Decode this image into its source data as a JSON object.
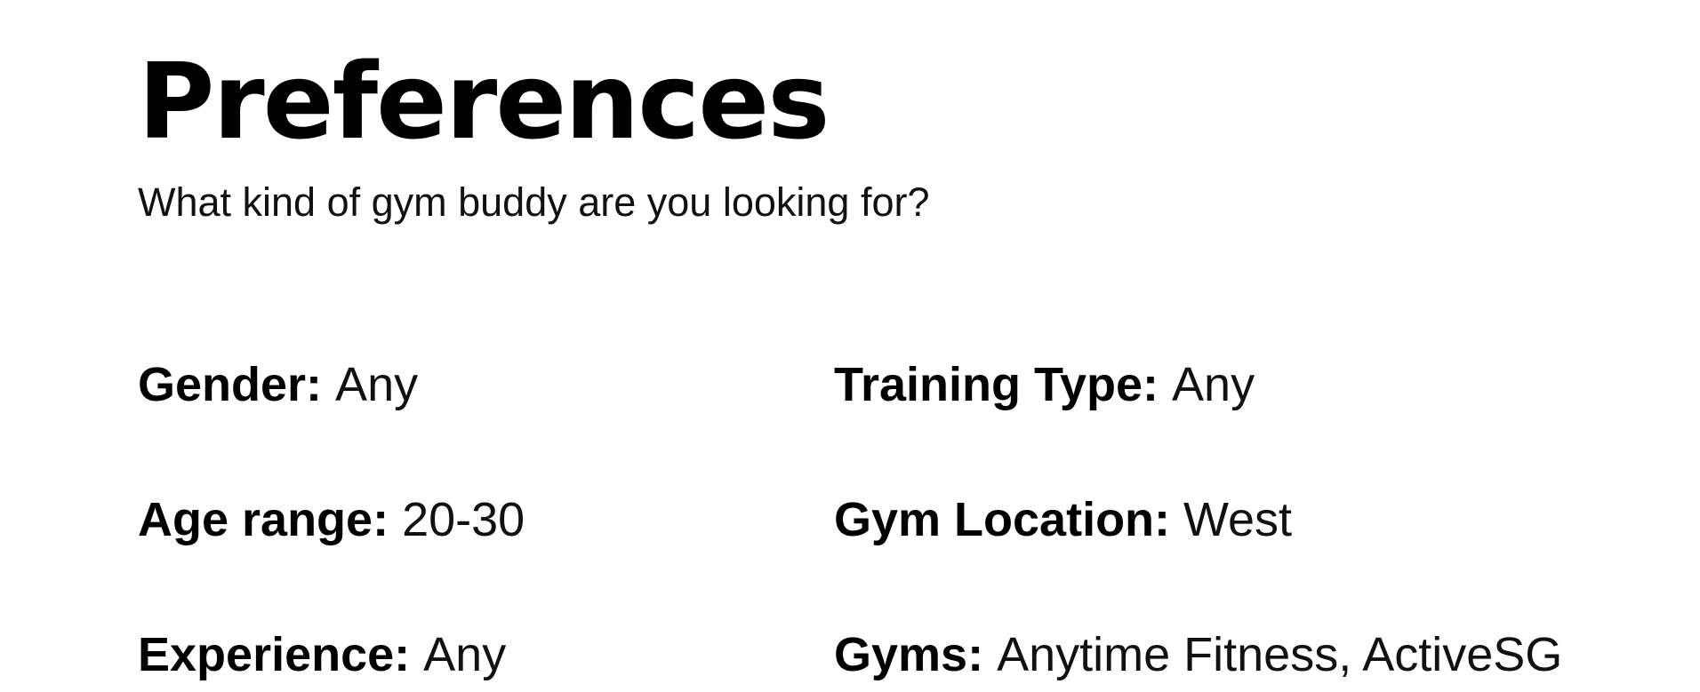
{
  "header": {
    "title": "Preferences",
    "subtitle": "What kind of gym buddy are you looking for?"
  },
  "preferences": {
    "gender": {
      "label": "Gender:",
      "value": "Any"
    },
    "age_range": {
      "label": "Age range:",
      "value": "20-30"
    },
    "experience": {
      "label": "Experience:",
      "value": "Any"
    },
    "training_type": {
      "label": "Training Type:",
      "value": "Any"
    },
    "gym_location": {
      "label": "Gym Location:",
      "value": "West"
    },
    "gyms": {
      "label": "Gyms:",
      "value": "Anytime Fitness, ActiveSG"
    }
  }
}
